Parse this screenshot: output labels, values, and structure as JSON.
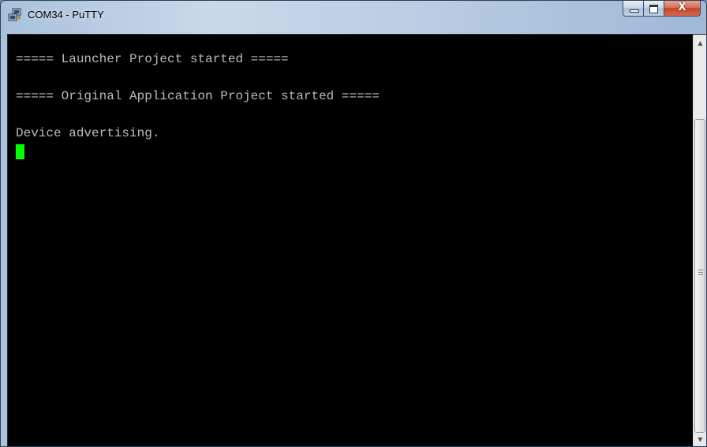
{
  "window": {
    "title": "COM34 - PuTTY",
    "icons": {
      "app": "putty-icon",
      "minimize": "minimize-icon",
      "maximize": "maximize-icon",
      "close": "close-icon"
    },
    "close_glyph": "X"
  },
  "terminal": {
    "background": "#000000",
    "foreground": "#bbbbbb",
    "cursor_color": "#00ff00",
    "lines": [
      "===== Launcher Project started =====",
      "",
      "===== Original Application Project started =====",
      "",
      "Device advertising."
    ]
  },
  "scrollbar": {
    "up_glyph": "▲",
    "down_glyph": "▼"
  }
}
